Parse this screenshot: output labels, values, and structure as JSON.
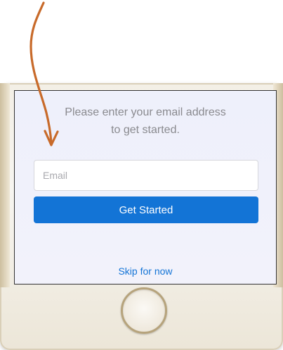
{
  "screen": {
    "prompt_line1": "Please enter your email address",
    "prompt_line2": "to get started.",
    "email_placeholder": "Email",
    "email_value": "",
    "get_started_label": "Get Started",
    "skip_label": "Skip for now"
  },
  "colors": {
    "accent_blue": "#1374d6",
    "annotation_arrow": "#c86a2a",
    "phone_gold": "#b6a37c"
  },
  "icons": {
    "annotation": "hand-drawn-arrow-icon",
    "home": "home-button"
  }
}
